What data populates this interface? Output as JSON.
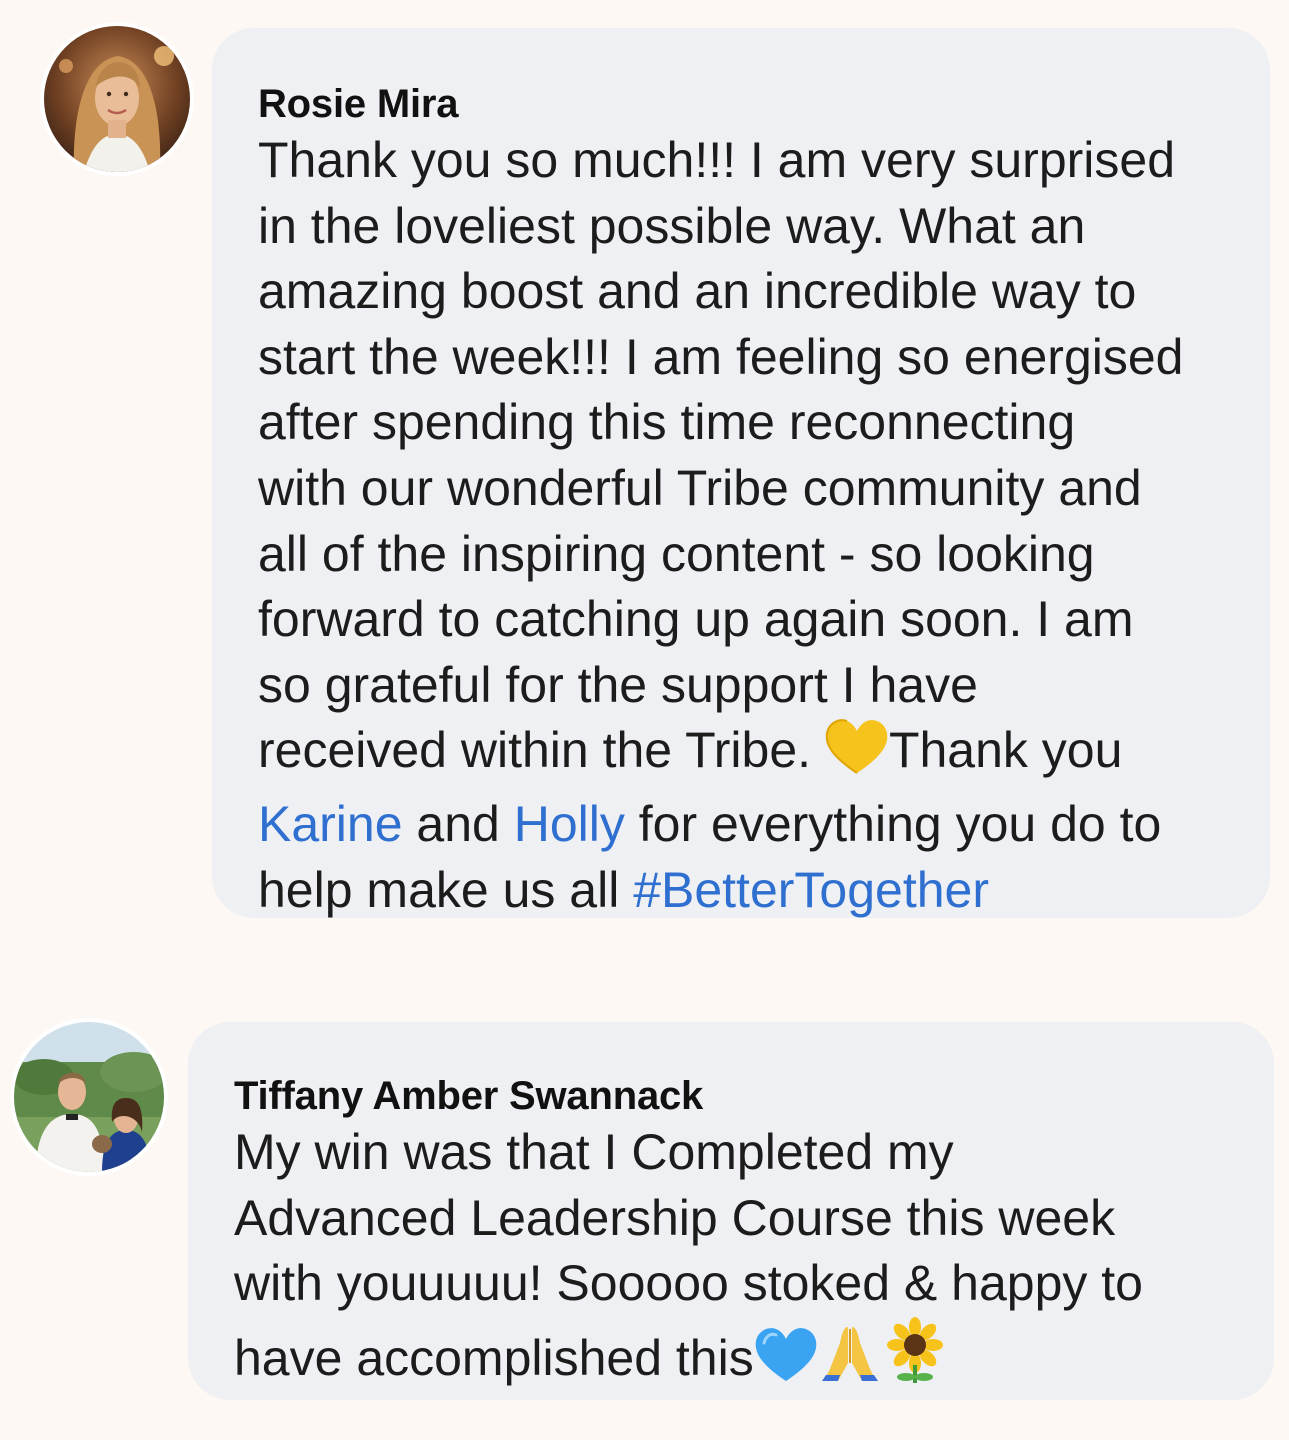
{
  "comments": [
    {
      "author": "Rosie Mira",
      "avatar_icon": "profile-photo-woman",
      "lines": [
        "Thank you so much!!! I am very surprised",
        "in the loveliest possible way. What an",
        "amazing boost and an incredible way to",
        "start the week!!! I am feeling so energised",
        "after spending this time reconnecting",
        "with our wonderful Tribe community and",
        "all of the inspiring content - so looking",
        "forward to catching up again soon. I am",
        "so grateful for the support I have",
        "received within the Tribe. ",
        "Thank you",
        " and ",
        " for everything you do to",
        "help make us all "
      ],
      "mentions": [
        "Karine",
        "Holly"
      ],
      "hashtag": "#BetterTogether",
      "emoji": [
        "yellow-heart-icon"
      ]
    },
    {
      "author": "Tiffany Amber Swannack",
      "avatar_icon": "profile-photo-couple",
      "lines": [
        "My win was that I Completed my",
        "Advanced Leadership Course this week",
        "with youuuuu! Sooooo stoked & happy to",
        "have accomplished this"
      ],
      "emoji": [
        "blue-heart-icon",
        "folded-hands-icon",
        "sunflower-icon"
      ]
    }
  ],
  "colors": {
    "page_background": "#fdf8f3",
    "bubble_background": "#eef0f4",
    "link": "#2e6fd0",
    "text": "#1c1c1c"
  }
}
